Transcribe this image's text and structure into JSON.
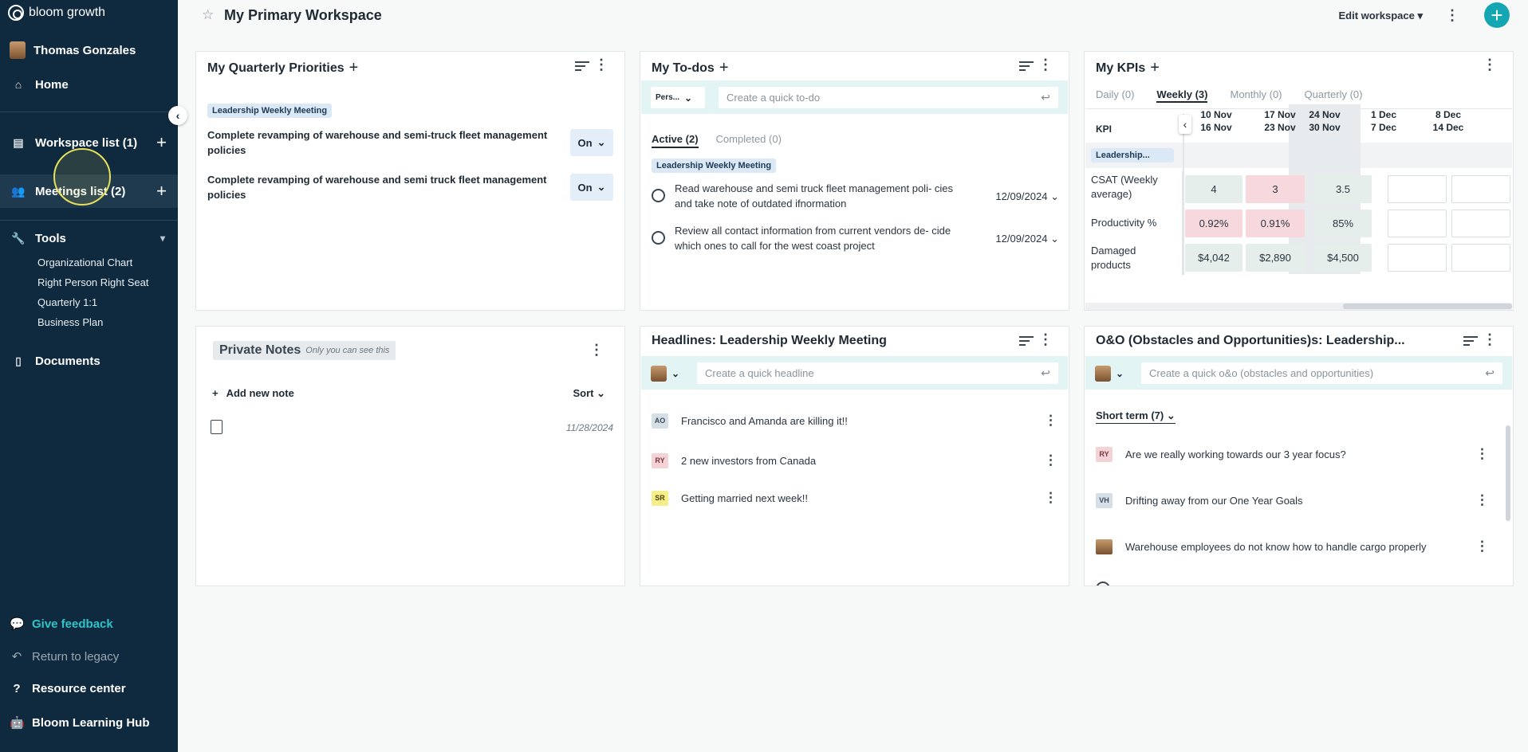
{
  "sidebar": {
    "brand": "bloom growth",
    "user_name": "Thomas Gonzales",
    "home": "Home",
    "workspace_list": "Workspace list (1)",
    "meetings_list": "Meetings list (2)",
    "tools": "Tools",
    "tools_items": [
      "Organizational Chart",
      "Right Person Right Seat",
      "Quarterly 1:1",
      "Business Plan"
    ],
    "documents": "Documents",
    "give_feedback": "Give feedback",
    "return_legacy": "Return to legacy",
    "resource_center": "Resource center",
    "learning_hub": "Bloom Learning Hub"
  },
  "header": {
    "title": "My Primary Workspace",
    "edit_workspace": "Edit workspace"
  },
  "priorities": {
    "title": "My Quarterly Priorities",
    "tag": "Leadership Weekly Meeting",
    "items": [
      {
        "text": "Complete revamping of warehouse and semi-truck fleet management policies",
        "status": "On"
      },
      {
        "text": "Complete revamping of warehouse and semi truck fleet management policies",
        "status": "On"
      }
    ]
  },
  "todos": {
    "title": "My To-dos",
    "owner_picker": "Pers...",
    "placeholder": "Create a quick to-do",
    "tab_active": "Active (2)",
    "tab_completed": "Completed (0)",
    "tag": "Leadership Weekly Meeting",
    "items": [
      {
        "text": "Read warehouse and semi truck fleet management poli- cies and take note of outdated ifnormation",
        "date": "12/09/2024"
      },
      {
        "text": "Review all contact information from current vendors de- cide which ones to call for the west coast project",
        "date": "12/09/2024"
      }
    ]
  },
  "kpis": {
    "title": "My KPIs",
    "tabs": [
      "Daily (0)",
      "Weekly (3)",
      "Monthly (0)",
      "Quarterly (0)"
    ],
    "kpi_header": "KPI",
    "tag": "Leadership...",
    "columns": [
      {
        "l1": "10 Nov",
        "l2": "16 Nov"
      },
      {
        "l1": "17 Nov",
        "l2": "23 Nov"
      },
      {
        "l1": "24 Nov",
        "l2": "30 Nov"
      },
      {
        "l1": "1 Dec",
        "l2": "7 Dec"
      },
      {
        "l1": "8 Dec",
        "l2": "14 Dec"
      }
    ],
    "rows": [
      {
        "label": "CSAT (Weekly average)",
        "values": [
          "4",
          "3",
          "3.5",
          "",
          ""
        ]
      },
      {
        "label": "Productivity %",
        "values": [
          "0.92%",
          "0.91%",
          "85%",
          "",
          ""
        ]
      },
      {
        "label": "Damaged products",
        "values": [
          "$4,042",
          "$2,890",
          "$4,500",
          "",
          ""
        ]
      }
    ]
  },
  "notes": {
    "title": "Private Notes",
    "subtitle": "Only you can see this",
    "add_note": "Add new note",
    "sort": "Sort",
    "note_date": "11/28/2024"
  },
  "headlines": {
    "title": "Headlines: Leadership Weekly Meeting",
    "placeholder": "Create a quick headline",
    "items": [
      {
        "initials": "AO",
        "text": "Francisco and Amanda are killing it!!",
        "color": "#d7dfe6"
      },
      {
        "initials": "RY",
        "text": "2 new investors from Canada",
        "color": "#f4d3d6"
      },
      {
        "initials": "SR",
        "text": "Getting married next week!!",
        "color": "#f6ee8a"
      }
    ]
  },
  "oo": {
    "title": "O&O (Obstacles and Opportunities)s: Leadership...",
    "placeholder": "Create a quick o&o (obstacles and opportunities)",
    "filter": "Short term (7)",
    "items": [
      {
        "initials": "RY",
        "text": "Are we really working towards our 3 year focus?",
        "color": "#f4d3d6"
      },
      {
        "initials": "VH",
        "text": "Drifting away from our One Year Goals",
        "color": "#d7dfe6"
      },
      {
        "initials": "",
        "text": "Warehouse employees do not know how to handle cargo properly",
        "color": ""
      }
    ]
  }
}
